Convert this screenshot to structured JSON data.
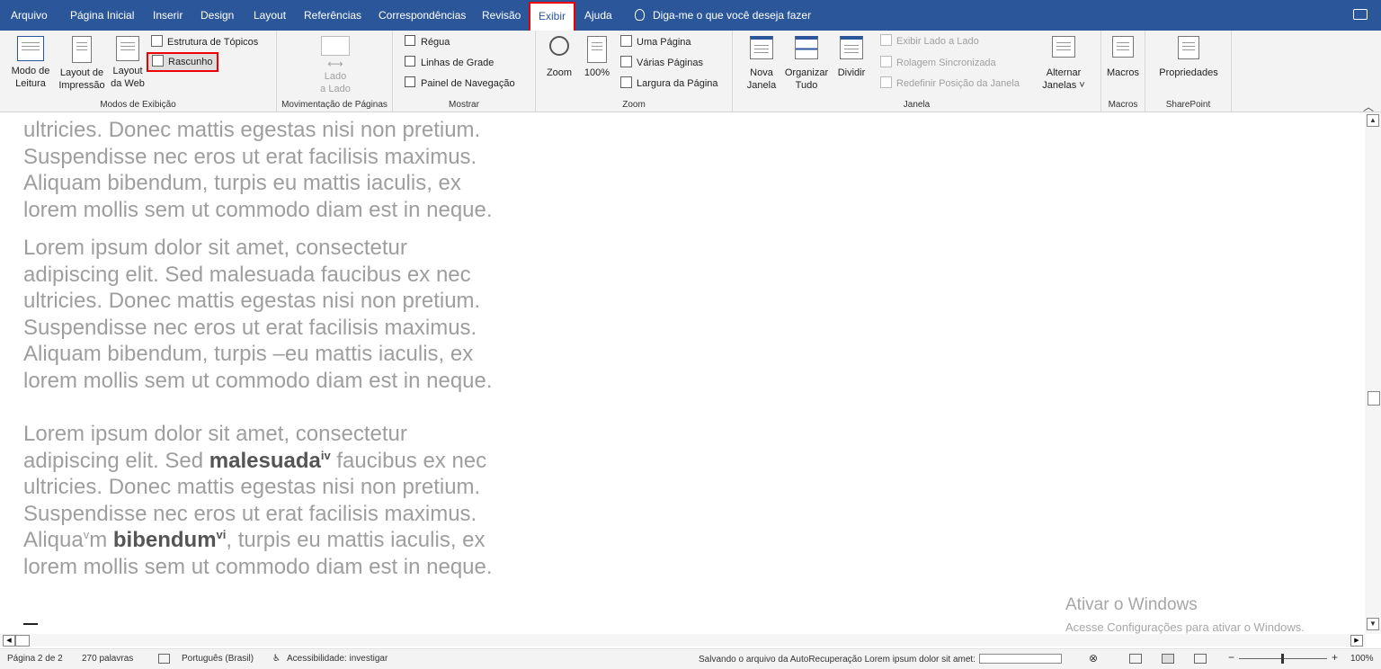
{
  "menu": {
    "tabs": [
      "Arquivo",
      "Página Inicial",
      "Inserir",
      "Design",
      "Layout",
      "Referências",
      "Correspondências",
      "Revisão",
      "Exibir",
      "Ajuda"
    ],
    "active_tab": "Exibir",
    "tell_me": "Diga-me o que você deseja fazer"
  },
  "ribbon": {
    "modos": {
      "label": "Modos de Exibição",
      "modo_leitura": [
        "Modo de",
        "Leitura"
      ],
      "layout_impressao": [
        "Layout de",
        "Impressão"
      ],
      "layout_web": [
        "Layout",
        "da Web"
      ],
      "estrutura": "Estrutura de Tópicos",
      "rascunho": "Rascunho"
    },
    "movimentacao": {
      "label": "Movimentação de Páginas",
      "lado": [
        "Lado",
        "a Lado"
      ]
    },
    "mostrar": {
      "label": "Mostrar",
      "regua": "Régua",
      "linhas": "Linhas de Grade",
      "painel": "Painel de Navegação"
    },
    "zoom": {
      "label": "Zoom",
      "zoom": "Zoom",
      "cem": "100%",
      "uma_pagina": "Uma Página",
      "varias": "Várias Páginas",
      "largura": "Largura da Página"
    },
    "janela": {
      "label": "Janela",
      "nova": [
        "Nova",
        "Janela"
      ],
      "organizar": [
        "Organizar",
        "Tudo"
      ],
      "dividir": "Dividir",
      "exibir_lado": "Exibir Lado a Lado",
      "rolagem": "Rolagem Sincronizada",
      "redefinir": "Redefinir Posição da Janela",
      "alternar": [
        "Alternar",
        "Janelas ˅"
      ]
    },
    "macros": {
      "label": "Macros",
      "macros": "Macros"
    },
    "sharepoint": {
      "label": "SharePoint",
      "propriedades": "Propriedades"
    }
  },
  "document": {
    "p1": [
      "ultricies. Donec mattis egestas nisi non pretium.",
      "Suspendisse nec eros ut erat facilisis maximus.",
      "Aliquam bibendum, turpis eu mattis iaculis, ex",
      "lorem mollis sem ut commodo diam est in neque."
    ],
    "p2": [
      "Lorem ipsum dolor sit amet, consectetur",
      "adipiscing elit. Sed malesuada faucibus ex nec",
      "ultricies. Donec mattis egestas nisi non pretium.",
      "Suspendisse nec eros ut erat facilisis maximus.",
      "Aliquam bibendum, turpis –eu mattis iaculis, ex",
      "lorem mollis sem ut commodo diam est in neque."
    ],
    "p3": {
      "l1": "Lorem ipsum dolor sit amet, consectetur",
      "l2a": "adipiscing elit. Sed ",
      "l2b": "malesuada",
      "l2sup": "iv",
      "l2c": " faucibus ex nec",
      "l3": "ultricies. Donec mattis egestas nisi non pretium.",
      "l4": "Suspendisse nec eros ut erat facilisis maximus.",
      "l5a": "Aliqua",
      "l5sup1": "v",
      "l5b": "m ",
      "l5c": "bibendum",
      "l5sup2": "vi",
      "l5d": ", turpis eu mattis iaculis, ex",
      "l6": "lorem mollis sem ut commodo diam est in neque."
    }
  },
  "watermark": {
    "title": "Ativar o Windows",
    "subtitle": "Acesse Configurações para ativar o Windows."
  },
  "status": {
    "pagina": "Página 2 de 2",
    "palavras": "270 palavras",
    "idioma": "Português (Brasil)",
    "acessibilidade": "Acessibilidade: investigar",
    "salvando": "Salvando o arquivo da AutoRecuperação Lorem ipsum dolor sit amet:",
    "zoom": "100%"
  }
}
